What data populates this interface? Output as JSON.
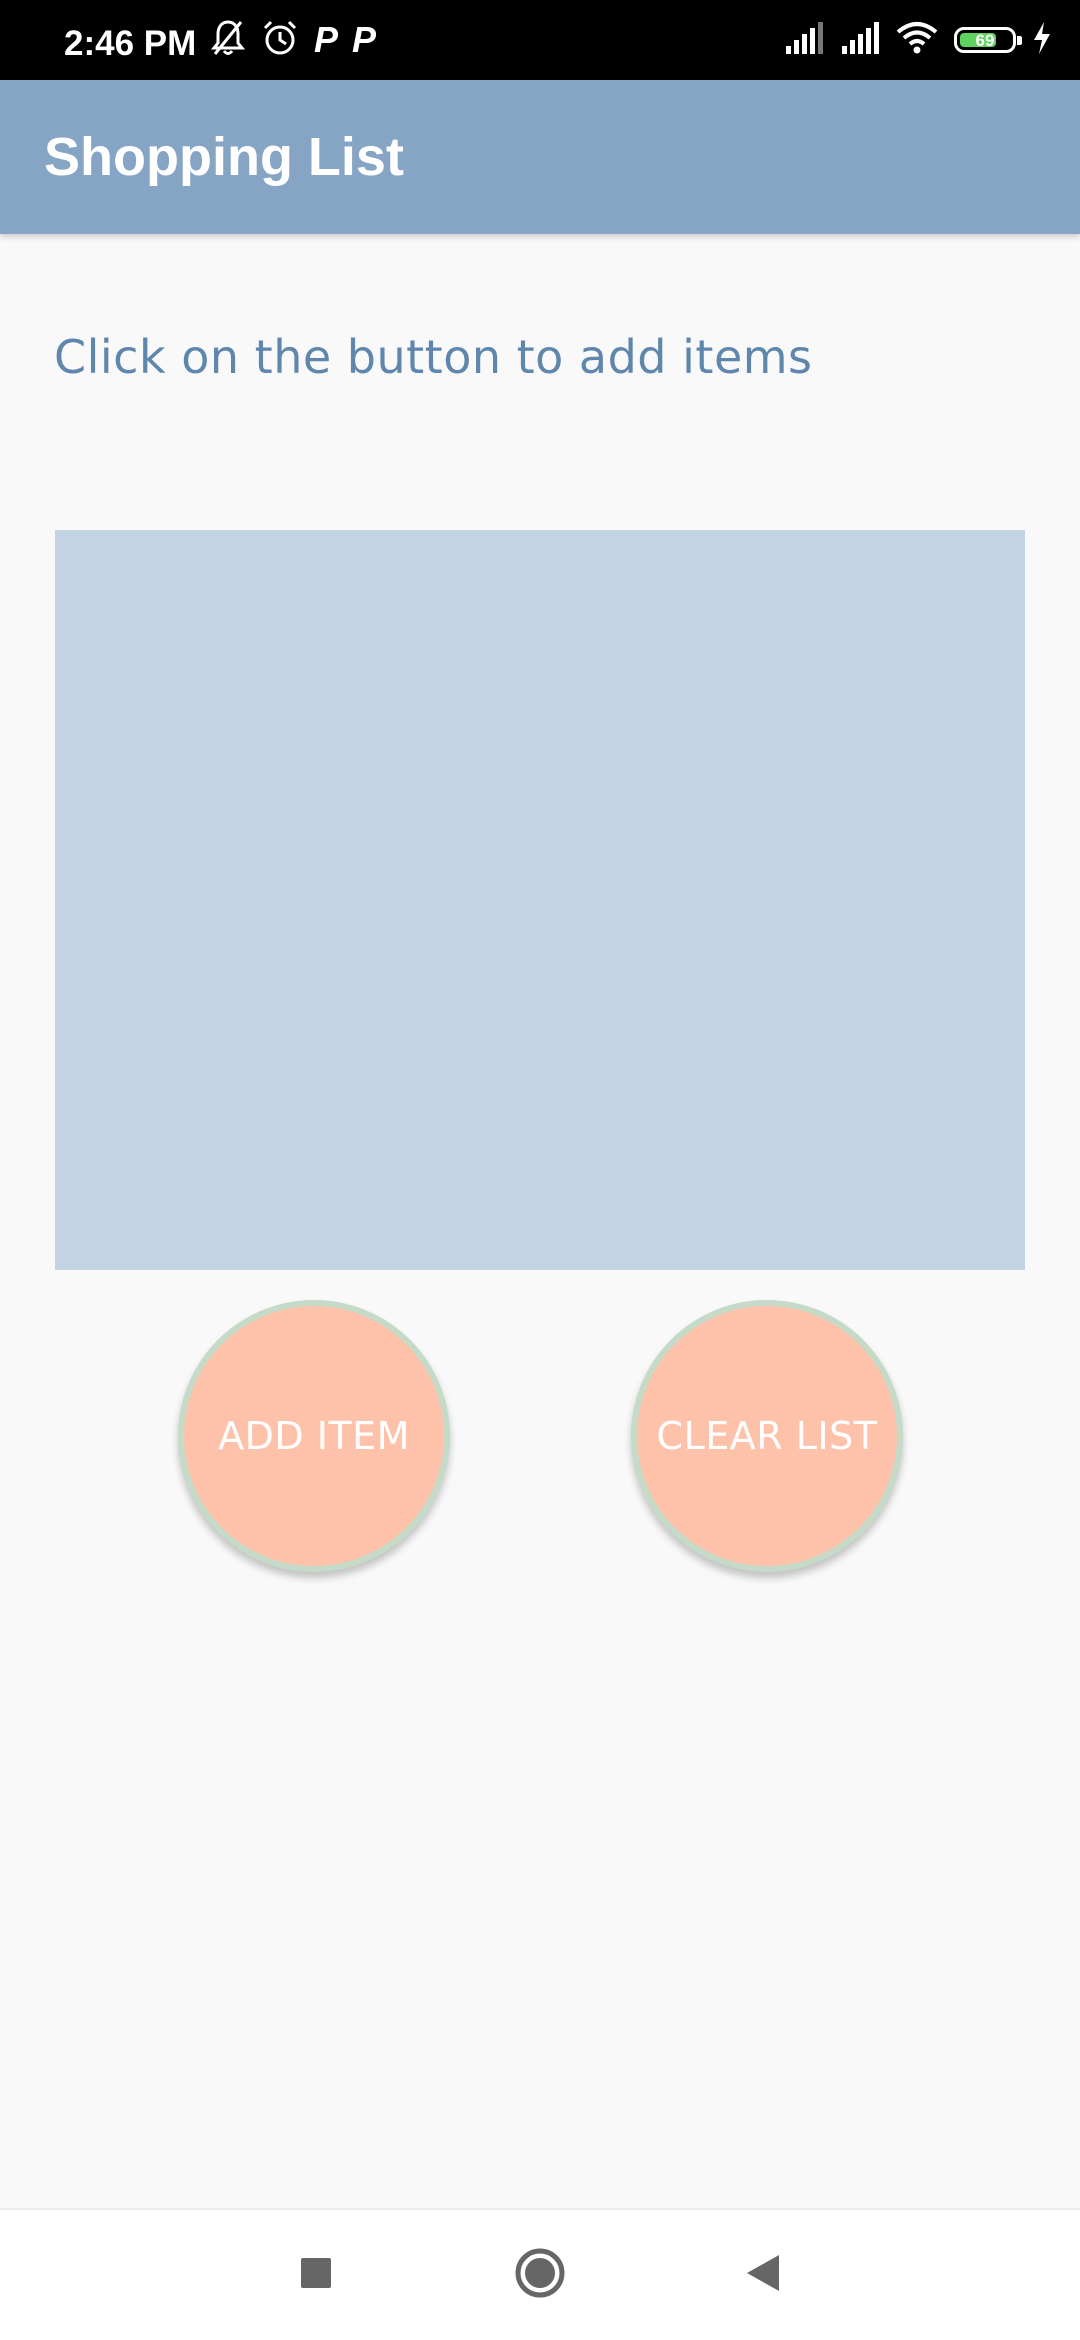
{
  "status_bar": {
    "time": "2:46 PM",
    "battery_level": "69",
    "left_icons": [
      "bell-off-icon",
      "alarm-icon",
      "p-notification-icon",
      "p-notification-icon"
    ],
    "right_icons": [
      "signal-icon",
      "signal-icon",
      "wifi-icon",
      "battery-icon",
      "charging-icon"
    ],
    "p_glyph": "P",
    "battery_color": "#5fd35f"
  },
  "app_bar": {
    "title": "Shopping List",
    "color": "#86a5c5"
  },
  "content": {
    "hint": "Click on the button to add items",
    "list_background": "#c3d3e3"
  },
  "buttons": {
    "add_label": "ADD ITEM",
    "clear_label": "CLEAR LIST",
    "fill_color": "#fec2aa",
    "ring_color": "#c6dac8"
  },
  "nav_bar": {
    "items": [
      "recent-apps-icon",
      "home-icon",
      "back-icon"
    ]
  }
}
